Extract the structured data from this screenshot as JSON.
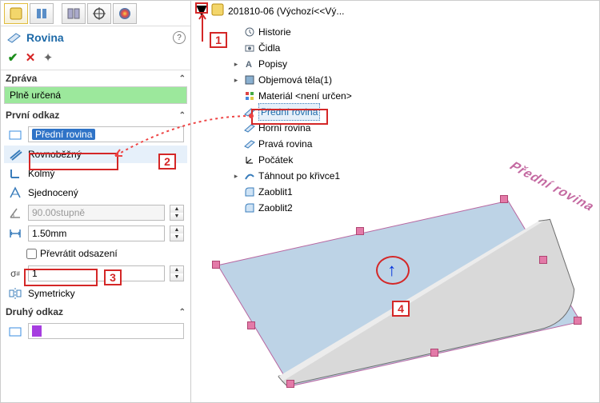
{
  "left": {
    "feature_title": "Rovina",
    "sections": {
      "message": "Zpráva",
      "message_body": "Plně určená",
      "ref1": "První odkaz",
      "ref2": "Druhý odkaz"
    },
    "ref1_value": "Přední rovina",
    "opts": {
      "parallel": "Rovnoběžný",
      "perpendicular": "Kolmý",
      "coincident": "Sjednocený",
      "angle_val": "90.00stupně",
      "distance_val": "1.50mm",
      "flip": "Převrátit odsazení",
      "instances_val": "1",
      "symmetric": "Symetricky"
    }
  },
  "document": {
    "name": "201810-06  (Výchozí<<Vý..."
  },
  "tree": {
    "history": "Historie",
    "sensors": "Čidla",
    "annotations": "Popisy",
    "bodies": "Objemová těla(1)",
    "material": "Materiál <není určen>",
    "front_plane": "Přední rovina",
    "top_plane": "Horní rovina",
    "right_plane": "Pravá rovina",
    "origin": "Počátek",
    "sweep1": "Táhnout po křivce1",
    "fillet1": "Zaoblit1",
    "fillet2": "Zaoblit2"
  },
  "viewport": {
    "plane_label": "Přední rovina"
  },
  "annotations": {
    "n1": "1",
    "n2": "2",
    "n3": "3",
    "n4": "4"
  }
}
